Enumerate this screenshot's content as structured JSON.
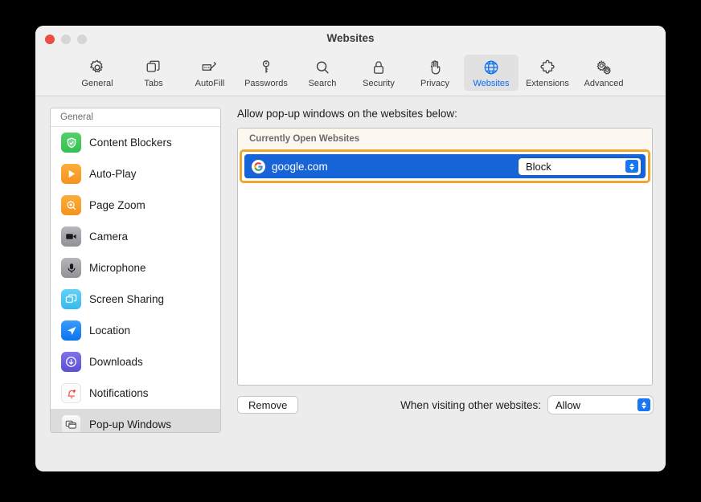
{
  "window": {
    "title": "Websites",
    "traffic_lights": [
      "close",
      "minimize",
      "maximize"
    ]
  },
  "toolbar": {
    "items": [
      {
        "label": "General",
        "icon": "gear-icon",
        "active": false
      },
      {
        "label": "Tabs",
        "icon": "tabs-icon",
        "active": false
      },
      {
        "label": "AutoFill",
        "icon": "autofill-icon",
        "active": false
      },
      {
        "label": "Passwords",
        "icon": "key-icon",
        "active": false
      },
      {
        "label": "Search",
        "icon": "search-icon",
        "active": false
      },
      {
        "label": "Security",
        "icon": "lock-icon",
        "active": false
      },
      {
        "label": "Privacy",
        "icon": "hand-icon",
        "active": false
      },
      {
        "label": "Websites",
        "icon": "globe-icon",
        "active": true
      },
      {
        "label": "Extensions",
        "icon": "puzzle-icon",
        "active": false
      },
      {
        "label": "Advanced",
        "icon": "gears-icon",
        "active": false
      }
    ],
    "active_color": "#0a6cf5"
  },
  "sidebar": {
    "header": "General",
    "items": [
      {
        "label": "Content Blockers",
        "icon": "shield-check-icon",
        "selected": false
      },
      {
        "label": "Auto-Play",
        "icon": "play-icon",
        "selected": false
      },
      {
        "label": "Page Zoom",
        "icon": "magnifier-plus-icon",
        "selected": false
      },
      {
        "label": "Camera",
        "icon": "camera-icon",
        "selected": false
      },
      {
        "label": "Microphone",
        "icon": "microphone-icon",
        "selected": false
      },
      {
        "label": "Screen Sharing",
        "icon": "screen-sharing-icon",
        "selected": false
      },
      {
        "label": "Location",
        "icon": "location-arrow-icon",
        "selected": false
      },
      {
        "label": "Downloads",
        "icon": "download-icon",
        "selected": false
      },
      {
        "label": "Notifications",
        "icon": "bell-icon",
        "selected": false
      },
      {
        "label": "Pop-up Windows",
        "icon": "popup-windows-icon",
        "selected": true
      }
    ]
  },
  "main": {
    "title": "Allow pop-up windows on the websites below:",
    "group_header": "Currently Open Websites",
    "rows": [
      {
        "site": "google.com",
        "favicon": "google-g-icon",
        "permission": "Block",
        "selected": true,
        "highlighted": true
      }
    ],
    "highlight_color": "#f0a72e",
    "selection_color": "#1664d8"
  },
  "bottom": {
    "remove_label": "Remove",
    "other_websites_label": "When visiting other websites:",
    "other_websites_value": "Allow"
  },
  "help": {
    "label": "?"
  }
}
